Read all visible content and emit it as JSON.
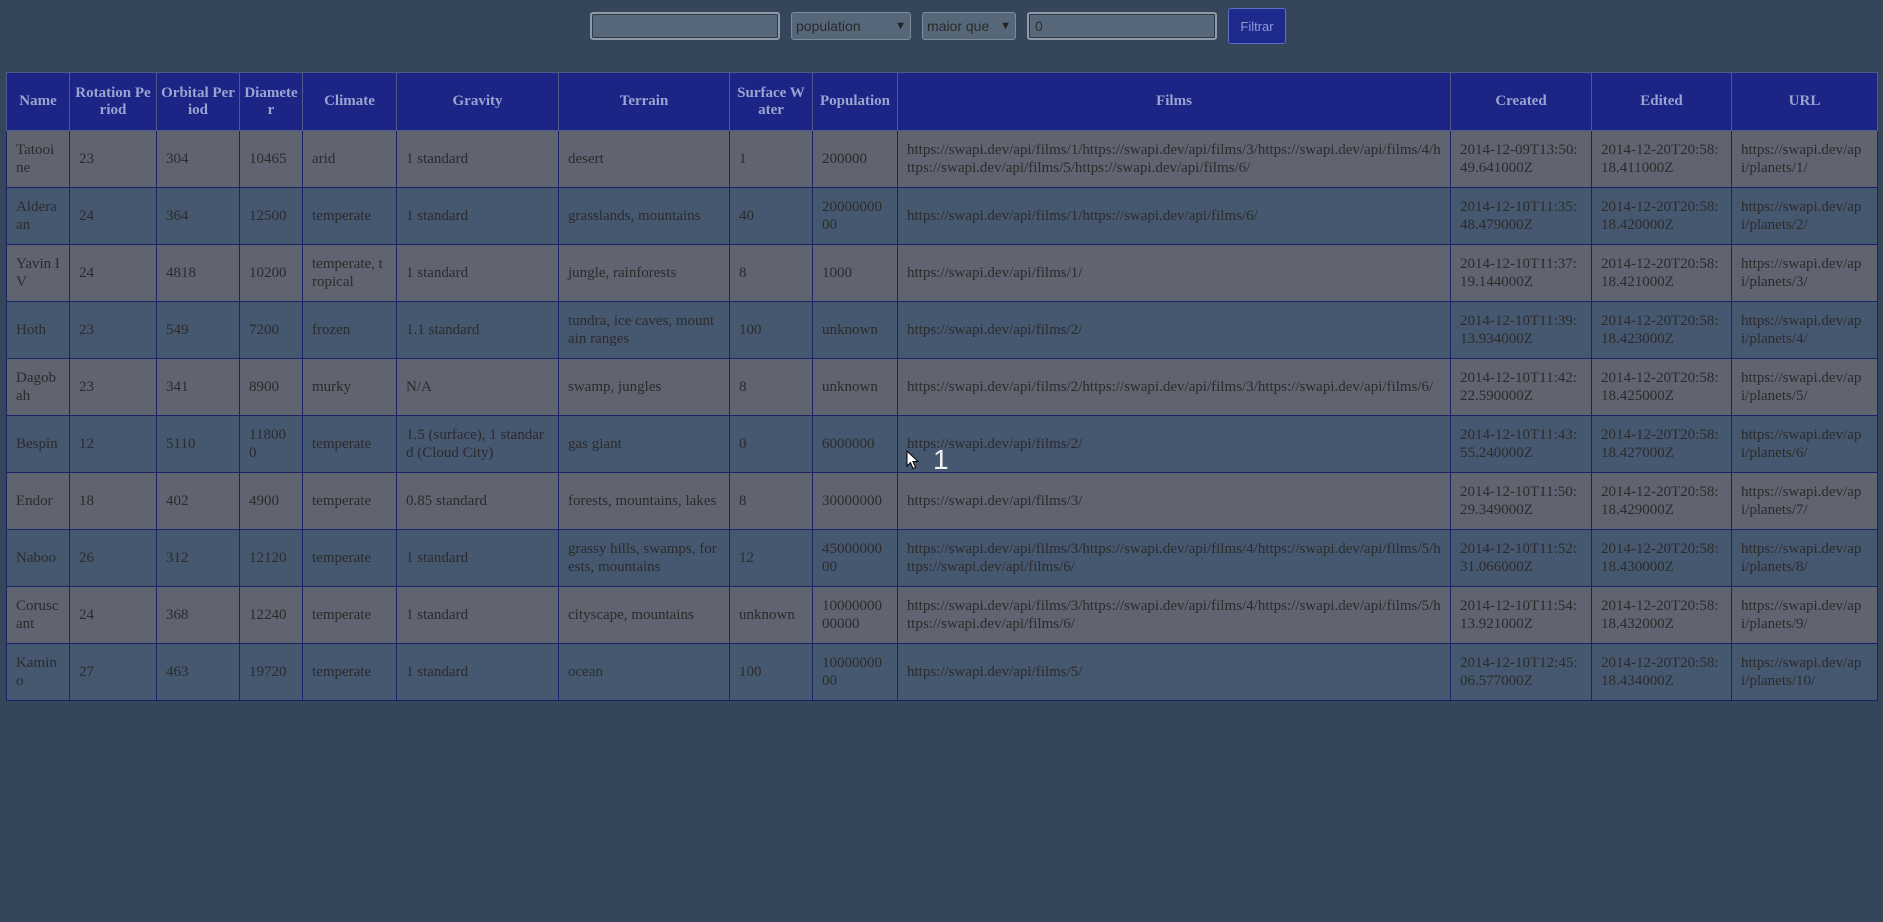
{
  "filters": {
    "name_value": "",
    "column_selected": "population",
    "comparison_selected": "maior que",
    "value": "0",
    "button_label": "Filtrar"
  },
  "table": {
    "headers": [
      "Name",
      "Rotation Period",
      "Orbital Period",
      "Diameter",
      "Climate",
      "Gravity",
      "Terrain",
      "Surface Water",
      "Population",
      "Films",
      "Created",
      "Edited",
      "URL"
    ],
    "rows": [
      [
        "Tatooine",
        "23",
        "304",
        "10465",
        "arid",
        "1 standard",
        "desert",
        "1",
        "200000",
        "https://swapi.dev/api/films/1/https://swapi.dev/api/films/3/https://swapi.dev/api/films/4/https://swapi.dev/api/films/5/https://swapi.dev/api/films/6/",
        "2014-12-09T13:50:49.641000Z",
        "2014-12-20T20:58:18.411000Z",
        "https://swapi.dev/api/planets/1/"
      ],
      [
        "Alderaan",
        "24",
        "364",
        "12500",
        "temperate",
        "1 standard",
        "grasslands, mountains",
        "40",
        "2000000000",
        "https://swapi.dev/api/films/1/https://swapi.dev/api/films/6/",
        "2014-12-10T11:35:48.479000Z",
        "2014-12-20T20:58:18.420000Z",
        "https://swapi.dev/api/planets/2/"
      ],
      [
        "Yavin IV",
        "24",
        "4818",
        "10200",
        "temperate, tropical",
        "1 standard",
        "jungle, rainforests",
        "8",
        "1000",
        "https://swapi.dev/api/films/1/",
        "2014-12-10T11:37:19.144000Z",
        "2014-12-20T20:58:18.421000Z",
        "https://swapi.dev/api/planets/3/"
      ],
      [
        "Hoth",
        "23",
        "549",
        "7200",
        "frozen",
        "1.1 standard",
        "tundra, ice caves, mountain ranges",
        "100",
        "unknown",
        "https://swapi.dev/api/films/2/",
        "2014-12-10T11:39:13.934000Z",
        "2014-12-20T20:58:18.423000Z",
        "https://swapi.dev/api/planets/4/"
      ],
      [
        "Dagobah",
        "23",
        "341",
        "8900",
        "murky",
        "N/A",
        "swamp, jungles",
        "8",
        "unknown",
        "https://swapi.dev/api/films/2/https://swapi.dev/api/films/3/https://swapi.dev/api/films/6/",
        "2014-12-10T11:42:22.590000Z",
        "2014-12-20T20:58:18.425000Z",
        "https://swapi.dev/api/planets/5/"
      ],
      [
        "Bespin",
        "12",
        "5110",
        "118000",
        "temperate",
        "1.5 (surface), 1 standard (Cloud City)",
        "gas giant",
        "0",
        "6000000",
        "https://swapi.dev/api/films/2/",
        "2014-12-10T11:43:55.240000Z",
        "2014-12-20T20:58:18.427000Z",
        "https://swapi.dev/api/planets/6/"
      ],
      [
        "Endor",
        "18",
        "402",
        "4900",
        "temperate",
        "0.85 standard",
        "forests, mountains, lakes",
        "8",
        "30000000",
        "https://swapi.dev/api/films/3/",
        "2014-12-10T11:50:29.349000Z",
        "2014-12-20T20:58:18.429000Z",
        "https://swapi.dev/api/planets/7/"
      ],
      [
        "Naboo",
        "26",
        "312",
        "12120",
        "temperate",
        "1 standard",
        "grassy hills, swamps, forests, mountains",
        "12",
        "4500000000",
        "https://swapi.dev/api/films/3/https://swapi.dev/api/films/4/https://swapi.dev/api/films/5/https://swapi.dev/api/films/6/",
        "2014-12-10T11:52:31.066000Z",
        "2014-12-20T20:58:18.430000Z",
        "https://swapi.dev/api/planets/8/"
      ],
      [
        "Coruscant",
        "24",
        "368",
        "12240",
        "temperate",
        "1 standard",
        "cityscape, mountains",
        "unknown",
        "1000000000000",
        "https://swapi.dev/api/films/3/https://swapi.dev/api/films/4/https://swapi.dev/api/films/5/https://swapi.dev/api/films/6/",
        "2014-12-10T11:54:13.921000Z",
        "2014-12-20T20:58:18.432000Z",
        "https://swapi.dev/api/planets/9/"
      ],
      [
        "Kamino",
        "27",
        "463",
        "19720",
        "temperate",
        "1 standard",
        "ocean",
        "100",
        "1000000000",
        "https://swapi.dev/api/films/5/",
        "2014-12-10T12:45:06.577000Z",
        "2014-12-20T20:58:18.434000Z",
        "https://swapi.dev/api/planets/10/"
      ]
    ]
  },
  "overlay": {
    "badge": "1"
  },
  "icons": {
    "cursor": "mouse-pointer-icon",
    "select_caret": "chevron-down-icon"
  },
  "colors": {
    "page_bg": "#35465b",
    "header_bg": "#1c2485",
    "button_bg": "#1e2a8c"
  }
}
